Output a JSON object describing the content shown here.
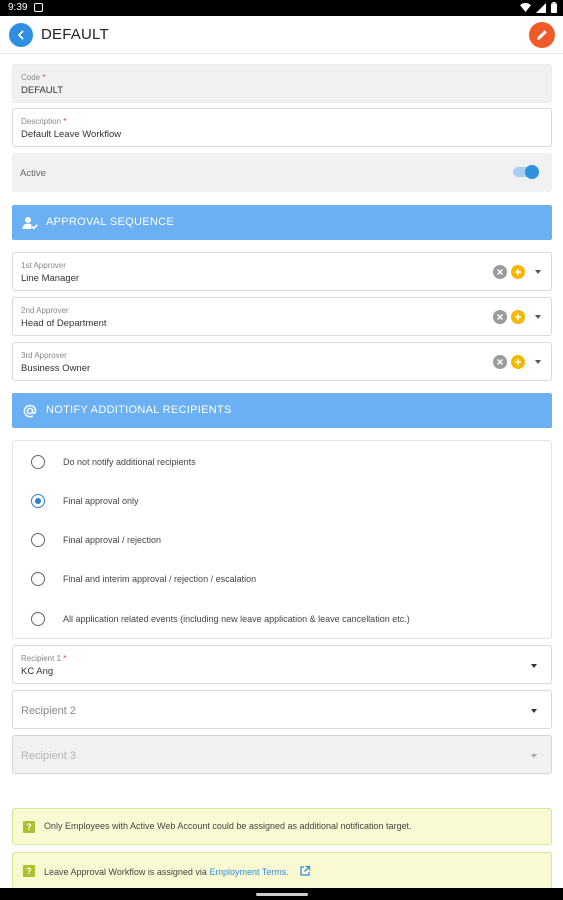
{
  "status_bar": {
    "time": "9:39"
  },
  "app_bar": {
    "title": "DEFAULT"
  },
  "form": {
    "code": {
      "label": "Code",
      "required_mark": "*",
      "value": "DEFAULT"
    },
    "description": {
      "label": "Description",
      "required_mark": "*",
      "value": "Default Leave Workflow"
    },
    "active": {
      "label": "Active",
      "checked": true
    }
  },
  "approval_section": {
    "title": "APPROVAL SEQUENCE",
    "approvers": [
      {
        "label": "1st Approver",
        "value": "Line Manager"
      },
      {
        "label": "2nd Approver",
        "value": "Head of Department"
      },
      {
        "label": "3rd Approver",
        "value": "Business Owner"
      }
    ]
  },
  "notify_section": {
    "title": "NOTIFY ADDITIONAL RECIPIENTS",
    "options": [
      {
        "label": "Do not notify additional recipients",
        "checked": false
      },
      {
        "label": "Final approval only",
        "checked": true
      },
      {
        "label": "Final approval / rejection",
        "checked": false
      },
      {
        "label": "Final and interim approval / rejection / escalation",
        "checked": false
      },
      {
        "label": "All application related events (including new leave application & leave cancellation etc.)",
        "checked": false
      }
    ]
  },
  "recipients": {
    "recipient1": {
      "label": "Recipient 1",
      "required_mark": "*",
      "value": "KC Ang"
    },
    "recipient2": {
      "placeholder": "Recipient 2"
    },
    "recipient3": {
      "placeholder": "Recipient 3",
      "disabled": true
    }
  },
  "notes": {
    "note1": {
      "text": "Only Employees with Active Web Account could be assigned as additional notification target."
    },
    "note2": {
      "text": "Leave Approval Workflow is assigned via",
      "link": "Employment Terms."
    }
  },
  "colors": {
    "accent_blue": "#2f8fe0",
    "section_blue": "#6ab0f3",
    "edit_orange": "#f05a28",
    "add_yellow": "#f5b800",
    "note_bg": "#fafad2",
    "required_red": "#e53935"
  }
}
